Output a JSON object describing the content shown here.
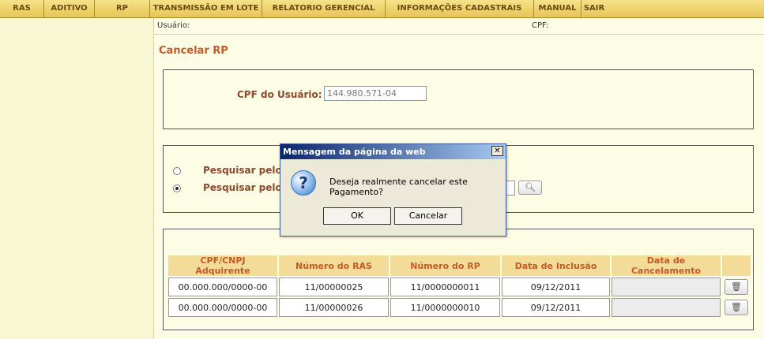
{
  "menu": [
    "RAS",
    "ADITIVO",
    "RP",
    "TRANSMISSÃO EM LOTE",
    "RELATORIO GERENCIAL",
    "INFORMAÇÕES CADASTRAIS",
    "MANUAL",
    "SAIR"
  ],
  "userbar": {
    "usuario_label": "Usuário:",
    "cpf_label": "CPF:"
  },
  "page_title": "Cancelar RP",
  "cpf_section": {
    "label": "CPF do Usuário:",
    "value": "144.980.571-04"
  },
  "search_section": {
    "option1": "Pesquisar pelo",
    "option2": "Pesquisar pelo",
    "selected": 2
  },
  "table": {
    "headers": [
      "CPF/CNPJ Adquirente",
      "Número do RAS",
      "Número do RP",
      "Data de Inclusão",
      "Data de Cancelamento"
    ],
    "rows": [
      [
        "00.000.000/0000-00",
        "11/00000025",
        "11/0000000011",
        "09/12/2011",
        ""
      ],
      [
        "00.000.000/0000-00",
        "11/00000026",
        "11/0000000010",
        "09/12/2011",
        ""
      ]
    ]
  },
  "dialog": {
    "title": "Mensagem da página da web",
    "close": "✕",
    "icon": "question-icon",
    "message": "Deseja realmente cancelar este Pagamento?",
    "ok_label": "OK",
    "cancel_label": "Cancelar"
  },
  "colors": {
    "accent": "#c45a28",
    "menu": "#e6c654",
    "background": "#fdfde6"
  }
}
